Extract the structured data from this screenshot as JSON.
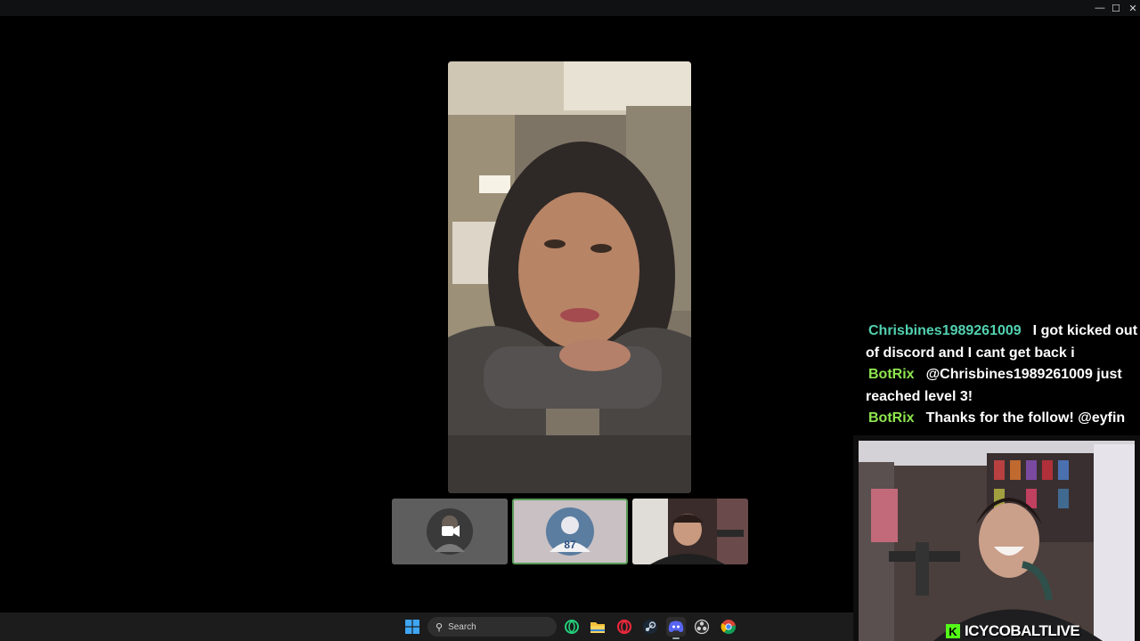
{
  "window": {
    "controls": {
      "minimize": "—",
      "maximize": "☐",
      "close": "✕"
    }
  },
  "chat": {
    "messages": [
      {
        "user": "Chrisbines1989261009",
        "user_color": "#52d1b0",
        "text": "I got kicked out of discord and I cant get back i"
      },
      {
        "user": "BotRix",
        "user_color": "#8fe64f",
        "text": "@Chrisbines1989261009 just reached level 3!"
      },
      {
        "user": "BotRix",
        "user_color": "#8fe64f",
        "text": "Thanks for the follow! @eyfin"
      }
    ]
  },
  "stream": {
    "logo_letter": "K",
    "channel": "ICYCOBALTLIVE",
    "brand_color": "#53fc18"
  },
  "taskbar": {
    "search_label": "Search",
    "icons": [
      "windows-start-icon",
      "opera-gx-icon",
      "file-explorer-icon",
      "opera-icon",
      "steam-icon",
      "discord-icon",
      "obs-icon",
      "chrome-icon"
    ]
  },
  "call": {
    "tiles": [
      "camera-off-participant",
      "avatar-participant",
      "streamer-video-participant"
    ],
    "active_speaker_border": "#5a9c5a"
  }
}
